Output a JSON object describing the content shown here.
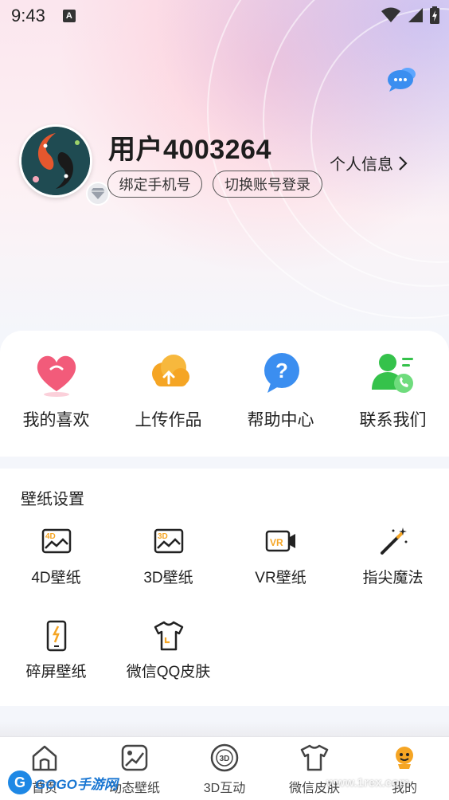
{
  "status_bar": {
    "time": "9:43",
    "notification_badge": "A"
  },
  "profile": {
    "username": "用户4003264",
    "bind_phone_label": "绑定手机号",
    "switch_account_label": "切换账号登录",
    "personal_info_label": "个人信息"
  },
  "quick_actions": [
    {
      "label": "我的喜欢",
      "icon": "heart-icon"
    },
    {
      "label": "上传作品",
      "icon": "cloud-upload-icon"
    },
    {
      "label": "帮助中心",
      "icon": "help-bubble-icon"
    },
    {
      "label": "联系我们",
      "icon": "contact-phone-icon"
    }
  ],
  "wallpaper_settings": {
    "title": "壁纸设置",
    "items": [
      {
        "label": "4D壁纸",
        "icon": "4d-frame-icon",
        "badge": "4D"
      },
      {
        "label": "3D壁纸",
        "icon": "3d-frame-icon",
        "badge": "3D"
      },
      {
        "label": "VR壁纸",
        "icon": "vr-camera-icon",
        "badge": "VR"
      },
      {
        "label": "指尖魔法",
        "icon": "magic-wand-icon"
      },
      {
        "label": "碎屏壁纸",
        "icon": "cracked-phone-icon"
      },
      {
        "label": "微信QQ皮肤",
        "icon": "tshirt-icon"
      }
    ]
  },
  "bottom_nav": [
    {
      "label": "首页",
      "icon": "home-icon"
    },
    {
      "label": "动态壁纸",
      "icon": "dynamic-wallpaper-icon"
    },
    {
      "label": "3D互动",
      "icon": "3d-circle-icon",
      "badge": "3D"
    },
    {
      "label": "微信皮肤",
      "icon": "tshirt-icon"
    },
    {
      "label": "我的",
      "icon": "mine-icon"
    }
  ],
  "watermark": {
    "logo": "G",
    "left_text": "GOGO手游网",
    "right_text": "www.1rex.com"
  },
  "colors": {
    "accent_orange": "#f5a524",
    "accent_blue": "#3b8ef0",
    "accent_green": "#35c24b",
    "accent_pink": "#f25b7a"
  }
}
